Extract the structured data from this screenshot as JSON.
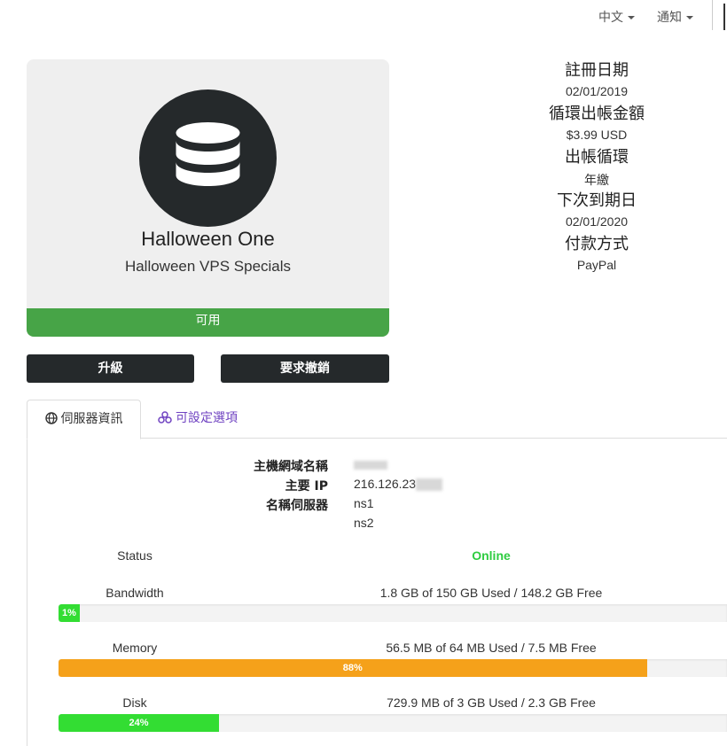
{
  "topnav": {
    "language": "中文",
    "notifications": "通知"
  },
  "product": {
    "icon": "database-icon",
    "name": "Halloween One",
    "group": "Halloween VPS Specials",
    "status": "可用",
    "status_color": "#47a447"
  },
  "info": {
    "reg_date_label": "註冊日期",
    "reg_date": "02/01/2019",
    "recurring_label": "循環出帳金額",
    "recurring": "$3.99 USD",
    "cycle_label": "出帳循環",
    "cycle": "年繳",
    "next_due_label": "下次到期日",
    "next_due": "02/01/2020",
    "payment_label": "付款方式",
    "payment": "PayPal"
  },
  "actions": {
    "upgrade": "升級",
    "cancel": "要求撤銷"
  },
  "tabs": {
    "server_info": "伺服器資訊",
    "config_options": "可設定選項",
    "active_color": "#333333",
    "inactive_color": "#6f42c1"
  },
  "server": {
    "hostname_label": "主機網域名稱",
    "hostname": "",
    "ip_label": "主要 IP",
    "ip": "216.126.23",
    "ns_label": "名稱伺服器",
    "ns1": "ns1",
    "ns2": "ns2"
  },
  "resources": {
    "status_label": "Status",
    "status_value": "Online",
    "status_color": "#2ecc40",
    "bandwidth": {
      "label": "Bandwidth",
      "text": "1.8 GB of 150 GB Used / 148.2 GB Free",
      "percent": 1,
      "percent_label": "1%",
      "color": "#33dd33"
    },
    "memory": {
      "label": "Memory",
      "text": "56.5 MB of 64 MB Used / 7.5 MB Free",
      "percent": 88,
      "percent_label": "88%",
      "color": "#f5a11a"
    },
    "disk": {
      "label": "Disk",
      "text": "729.9 MB of 3 GB Used / 2.3 GB Free",
      "percent": 24,
      "percent_label": "24%",
      "color": "#33dd33"
    }
  }
}
